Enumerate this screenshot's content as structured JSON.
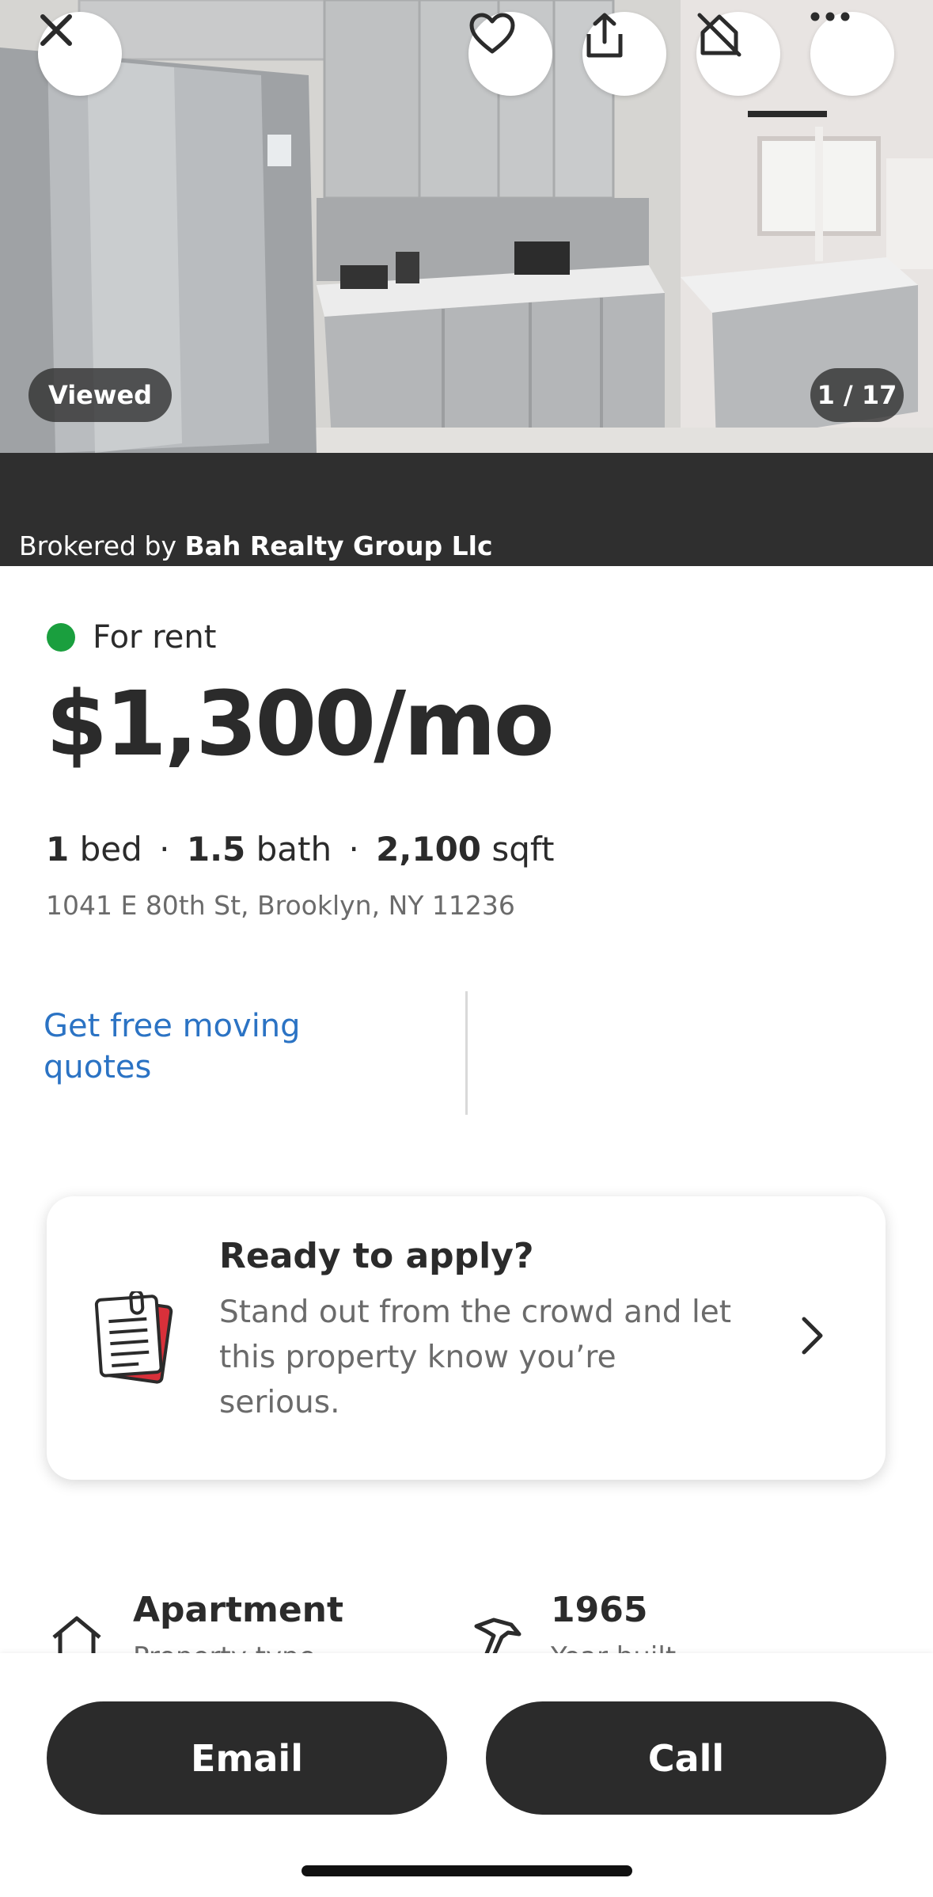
{
  "hero": {
    "viewed_badge": "Viewed",
    "photo_counter": "1 / 17",
    "broker_prefix": "Brokered by",
    "broker_name": "Bah Realty Group Llc"
  },
  "listing": {
    "status": "For rent",
    "status_color": "#1a9f3e",
    "price": "$1,300/mo",
    "beds_value": "1",
    "beds_label": "bed",
    "baths_value": "1.5",
    "baths_label": "bath",
    "sqft_value": "2,100",
    "sqft_label": "sqft",
    "separator": "·",
    "address": "1041 E 80th St, Brooklyn, NY 11236"
  },
  "moving_link": "Get free moving quotes",
  "apply_card": {
    "title": "Ready to apply?",
    "description": "Stand out from the crowd and let this property know you’re serious."
  },
  "facts": [
    {
      "title": "Apartment",
      "subtitle": "Property type"
    },
    {
      "title": "1965",
      "subtitle": "Year built"
    }
  ],
  "actions": {
    "email_label": "Email",
    "call_label": "Call"
  },
  "icons": [
    "close-icon",
    "heart-icon",
    "share-icon",
    "hide-home-icon",
    "more-icon",
    "document-icon",
    "chevron-right-icon",
    "house-icon",
    "hammer-icon"
  ],
  "colors": {
    "link": "#2b73c4",
    "button_bg": "#2b2b2b",
    "broker_bar": "#2f2f2f"
  }
}
